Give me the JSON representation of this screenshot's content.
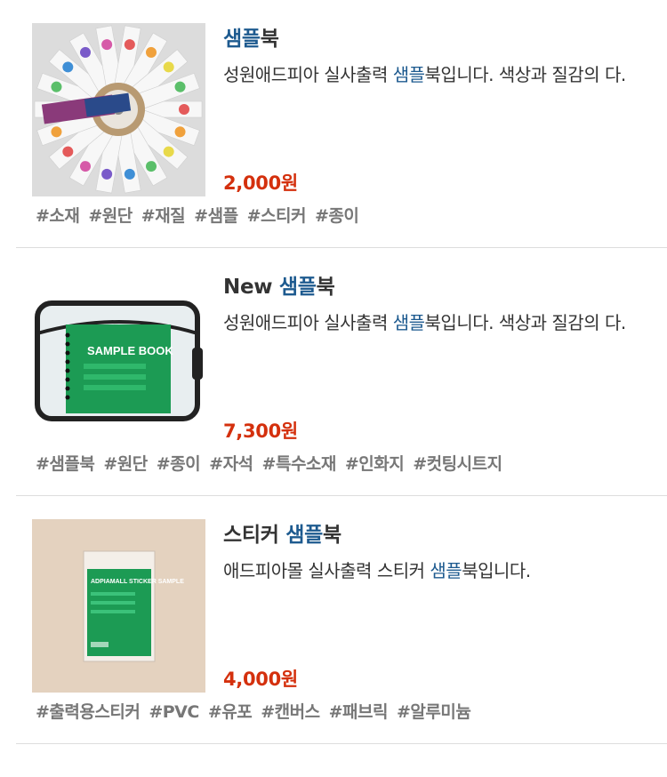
{
  "products": [
    {
      "title_prefix": "",
      "title_highlight": "샘플",
      "title_suffix": "북",
      "desc_prefix": "성원애드피아 실사출력 ",
      "desc_highlight": "샘플",
      "desc_suffix": "북입니다. 색상과 질감의 다.",
      "price": "2,000원",
      "tags": [
        "#소재",
        "#원단",
        "#재질",
        "#샘플",
        "#스티커",
        "#종이"
      ]
    },
    {
      "title_prefix": "New ",
      "title_highlight": "샘플",
      "title_suffix": "북",
      "desc_prefix": "성원애드피아 실사출력 ",
      "desc_highlight": "샘플",
      "desc_suffix": "북입니다. 색상과 질감의 다.",
      "price": "7,300원",
      "tags": [
        "#샘플북",
        "#원단",
        "#종이",
        "#자석",
        "#특수소재",
        "#인화지",
        "#컷팅시트지"
      ]
    },
    {
      "title_prefix": "스티커 ",
      "title_highlight": "샘플",
      "title_suffix": "북",
      "desc_prefix": "애드피아몰 실사출력 스티커 ",
      "desc_highlight": "샘플",
      "desc_suffix": "북입니다.",
      "price": "4,000원",
      "tags": [
        "#출력용스티커",
        "#PVC",
        "#유포",
        "#캔버스",
        "#패브릭",
        "#알루미늄"
      ]
    }
  ],
  "images": {
    "product_2_cover_text": "SAMPLE BOOK",
    "product_3_pack_text": "ADPIAMALL STICKER SAMPLE"
  },
  "colors": {
    "highlight": "#1d5a8f",
    "price": "#d4300d",
    "tag": "#777777",
    "book_green": "#1c9b54"
  }
}
